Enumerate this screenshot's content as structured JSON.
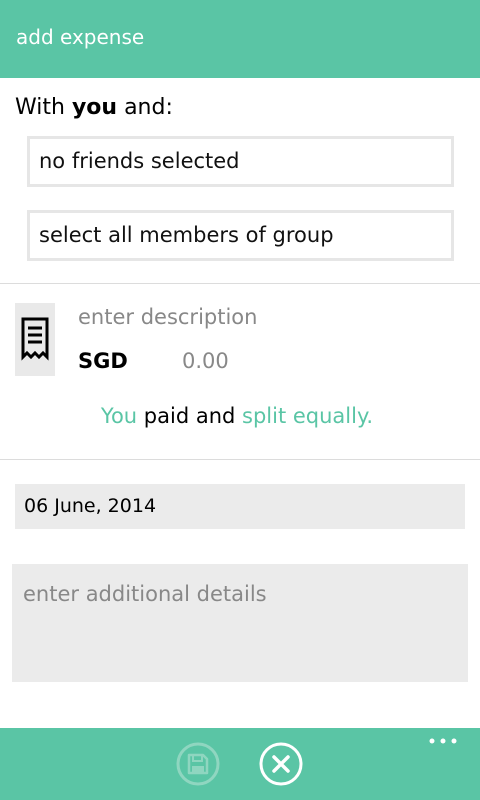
{
  "header": {
    "title": "add expense"
  },
  "participants": {
    "prefix": "With ",
    "you": "you",
    "suffix": " and:",
    "friends_field": "no friends selected",
    "group_button": "select all members of group"
  },
  "expense": {
    "icon": "receipt-icon",
    "description_placeholder": "enter description",
    "currency": "SGD",
    "amount_placeholder": "0.00",
    "payer": "You",
    "paid_and": " paid and ",
    "split_mode": "split equally."
  },
  "date": {
    "value": "06 June, 2014"
  },
  "details": {
    "placeholder": "enter additional details"
  },
  "appbar": {
    "save_icon": "save-icon",
    "cancel_icon": "close-icon",
    "more_icon": "more-icon"
  },
  "colors": {
    "accent": "#5ac5a5",
    "field_background": "#ebebeb",
    "placeholder_text": "#888888"
  }
}
